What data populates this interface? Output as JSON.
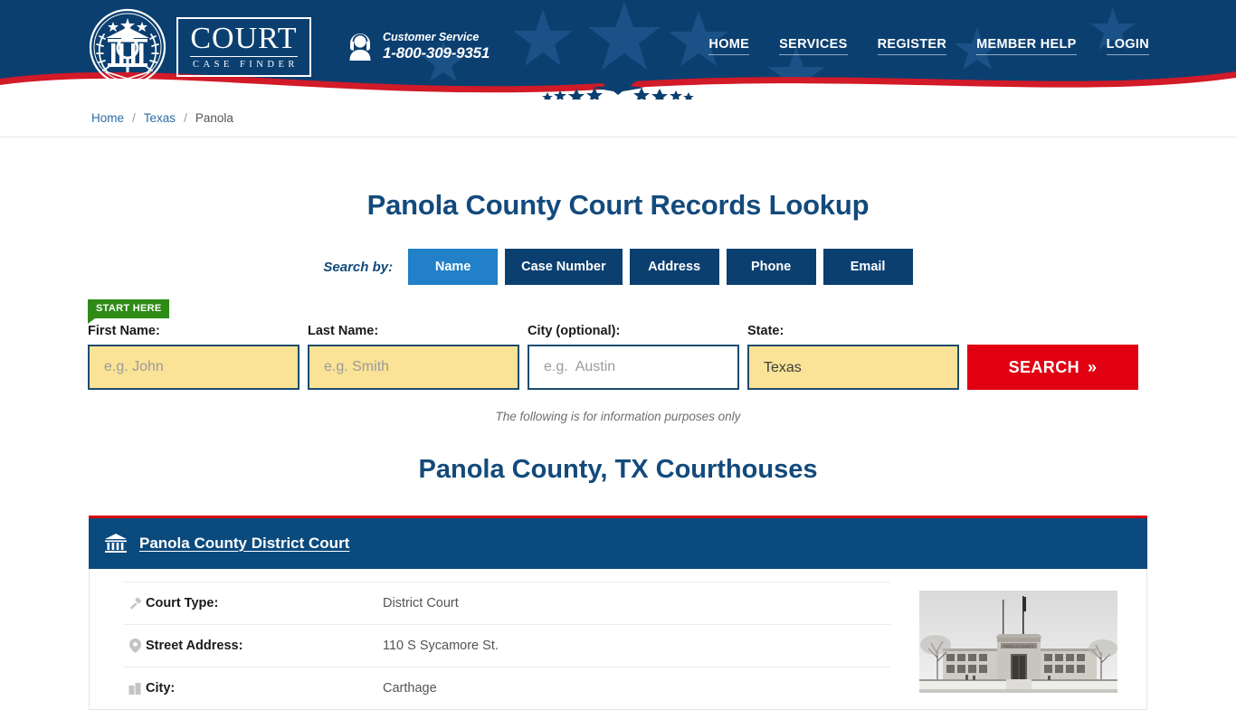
{
  "header": {
    "logo": {
      "word": "COURT",
      "sub": "CASE FINDER",
      "icon": "court-emblem-icon"
    },
    "customer_service": {
      "label": "Customer Service",
      "phone": "1-800-309-9351",
      "icon": "headset-agent-icon"
    },
    "nav": [
      {
        "label": "HOME"
      },
      {
        "label": "SERVICES"
      },
      {
        "label": "REGISTER"
      },
      {
        "label": "MEMBER HELP"
      },
      {
        "label": "LOGIN"
      }
    ],
    "colors": {
      "navy": "#0b3f70",
      "red": "#d90012",
      "white": "#ffffff"
    }
  },
  "breadcrumb": {
    "home": "Home",
    "state": "Texas",
    "county": "Panola",
    "separator": "/"
  },
  "page": {
    "title": "Panola County Court Records Lookup",
    "disclaimer": "The following is for information purposes only",
    "section_title": "Panola County, TX Courthouses"
  },
  "search": {
    "search_by_label": "Search by:",
    "tabs": [
      {
        "label": "Name",
        "active": true
      },
      {
        "label": "Case Number",
        "active": false
      },
      {
        "label": "Address",
        "active": false
      },
      {
        "label": "Phone",
        "active": false
      },
      {
        "label": "Email",
        "active": false
      }
    ],
    "start_here_badge": "START HERE",
    "fields": {
      "first_name": {
        "label": "First Name:",
        "placeholder": "e.g. John",
        "value": ""
      },
      "last_name": {
        "label": "Last Name:",
        "placeholder": "e.g. Smith",
        "value": ""
      },
      "city": {
        "label": "City (optional):",
        "placeholder": "e.g.  Austin",
        "value": ""
      },
      "state": {
        "label": "State:",
        "value": "Texas"
      }
    },
    "submit_label": "SEARCH",
    "submit_chevron": "»",
    "colors": {
      "active_tab": "#2180c8",
      "inactive_tab": "#0b3f70",
      "field_fill": "#fae396",
      "submit": "#e00011",
      "badge": "#2e8b16"
    }
  },
  "courts": [
    {
      "name": "Panola County District Court",
      "icon": "bank-building-icon",
      "photo_alt": "Panola County courthouse black and white photo",
      "rows": [
        {
          "icon": "gavel-icon",
          "label": "Court Type:",
          "value": "District Court"
        },
        {
          "icon": "map-pin-icon",
          "label": "Street Address:",
          "value": "110 S Sycamore St."
        },
        {
          "icon": "city-icon",
          "label": "City:",
          "value": "Carthage"
        }
      ]
    }
  ]
}
